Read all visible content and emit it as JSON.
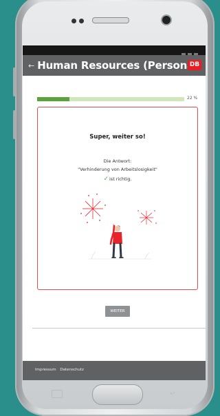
{
  "app": {
    "title": "Human Resources (Personal)",
    "back_icon": "arrow-left-icon",
    "logo_text": "DB"
  },
  "progress": {
    "value": 0.22,
    "label": "22 %"
  },
  "card": {
    "title": "Super, weiter so!",
    "answer_label": "Die Antwort:",
    "answer_text": "\"Verhinderung von Arbeitslosigkeit\"",
    "result_icon": "checkmark-icon",
    "result_text": "ist richtig.",
    "illustration": "celebrating-person-with-fireworks"
  },
  "actions": {
    "continue_label": "WEITER"
  },
  "footer": {
    "links": [
      "Impressum",
      "Datenschutz"
    ]
  },
  "colors": {
    "background": "#2a8f8a",
    "app_bar": "#5f6163",
    "accent_red": "#ec1c24",
    "progress_fill": "#5aa33a",
    "progress_track": "#cfe7b9",
    "card_border": "#e24a4f"
  }
}
